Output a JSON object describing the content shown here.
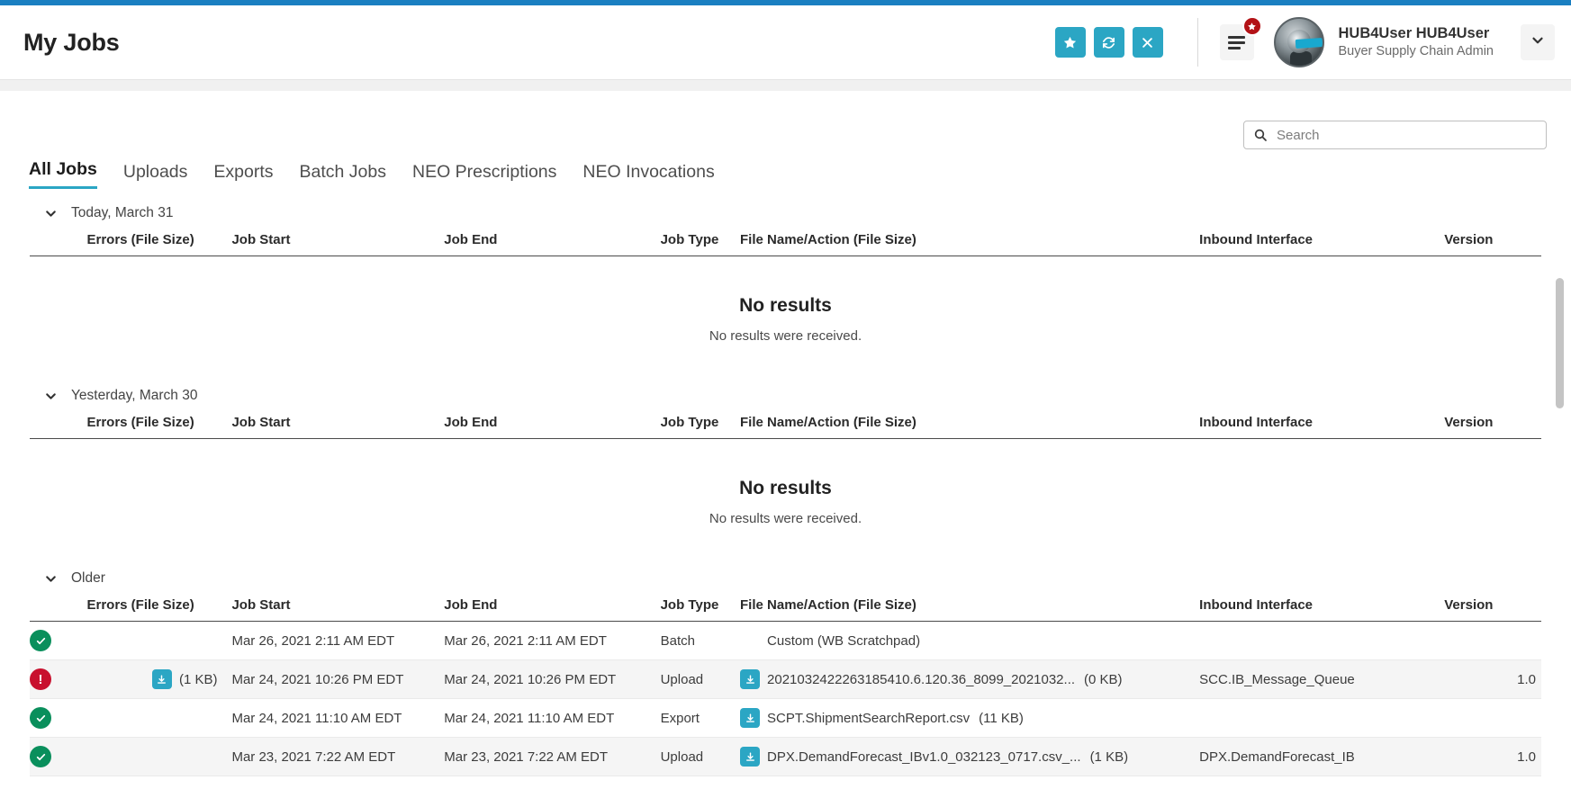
{
  "header": {
    "title": "My Jobs",
    "actions": [
      {
        "name": "favorite-button",
        "icon": "star-icon",
        "label": "Favorite"
      },
      {
        "name": "refresh-button",
        "icon": "refresh-icon",
        "label": "Refresh"
      },
      {
        "name": "close-button",
        "icon": "close-icon",
        "label": "Close"
      }
    ],
    "menu": {
      "icon": "hamburger-menu-icon",
      "badge_icon": "star-badge-icon"
    },
    "user": {
      "name": "HUB4User HUB4User",
      "role": "Buyer Supply Chain Admin",
      "avatar_icon": "user-avatar",
      "caret_icon": "chevron-down-icon"
    }
  },
  "search": {
    "placeholder": "Search",
    "value": "",
    "icon": "search-icon"
  },
  "tabs": [
    {
      "label": "All Jobs",
      "active": true
    },
    {
      "label": "Uploads",
      "active": false
    },
    {
      "label": "Exports",
      "active": false
    },
    {
      "label": "Batch Jobs",
      "active": false
    },
    {
      "label": "NEO Prescriptions",
      "active": false
    },
    {
      "label": "NEO Invocations",
      "active": false
    }
  ],
  "columns": {
    "errors": "Errors (File Size)",
    "job_start": "Job Start",
    "job_end": "Job End",
    "job_type": "Job Type",
    "file_name": "File Name/Action (File Size)",
    "inbound_interface": "Inbound Interface",
    "version": "Version"
  },
  "empty_state": {
    "title": "No results",
    "subtitle": "No results were received."
  },
  "sections": [
    {
      "title": "Today, March 31",
      "expanded": true,
      "empty": true,
      "rows": []
    },
    {
      "title": "Yesterday, March 30",
      "expanded": true,
      "empty": true,
      "rows": []
    },
    {
      "title": "Older",
      "expanded": true,
      "empty": false,
      "rows": [
        {
          "status": "success",
          "errors": "",
          "error_has_icon": false,
          "job_start": "Mar 26, 2021 2:11 AM EDT",
          "job_end": "Mar 26, 2021 2:11 AM EDT",
          "job_type": "Batch",
          "file_name": "Custom (WB Scratchpad)",
          "file_has_icon": false,
          "file_size": "",
          "inbound_interface": "",
          "version": ""
        },
        {
          "status": "error",
          "errors": "(1 KB)",
          "error_has_icon": true,
          "job_start": "Mar 24, 2021 10:26 PM EDT",
          "job_end": "Mar 24, 2021 10:26 PM EDT",
          "job_type": "Upload",
          "file_name": "2021032422263185410.6.120.36_8099_2021032...",
          "file_has_icon": true,
          "file_size": "(0 KB)",
          "inbound_interface": "SCC.IB_Message_Queue",
          "version": "1.0"
        },
        {
          "status": "success",
          "errors": "",
          "error_has_icon": false,
          "job_start": "Mar 24, 2021 11:10 AM EDT",
          "job_end": "Mar 24, 2021 11:10 AM EDT",
          "job_type": "Export",
          "file_name": "SCPT.ShipmentSearchReport.csv",
          "file_has_icon": true,
          "file_size": "(11 KB)",
          "inbound_interface": "",
          "version": ""
        },
        {
          "status": "success",
          "errors": "",
          "error_has_icon": false,
          "job_start": "Mar 23, 2021 7:22 AM EDT",
          "job_end": "Mar 23, 2021 7:22 AM EDT",
          "job_type": "Upload",
          "file_name": "DPX.DemandForecast_IBv1.0_032123_0717.csv_...",
          "file_has_icon": true,
          "file_size": "(1 KB)",
          "inbound_interface": "DPX.DemandForecast_IB",
          "version": "1.0"
        }
      ]
    }
  ],
  "colors": {
    "accent": "#2ba6c4",
    "top_strip": "#1a7fc1",
    "success": "#0a8f5c",
    "error": "#c8102e",
    "badge": "#b31216"
  }
}
